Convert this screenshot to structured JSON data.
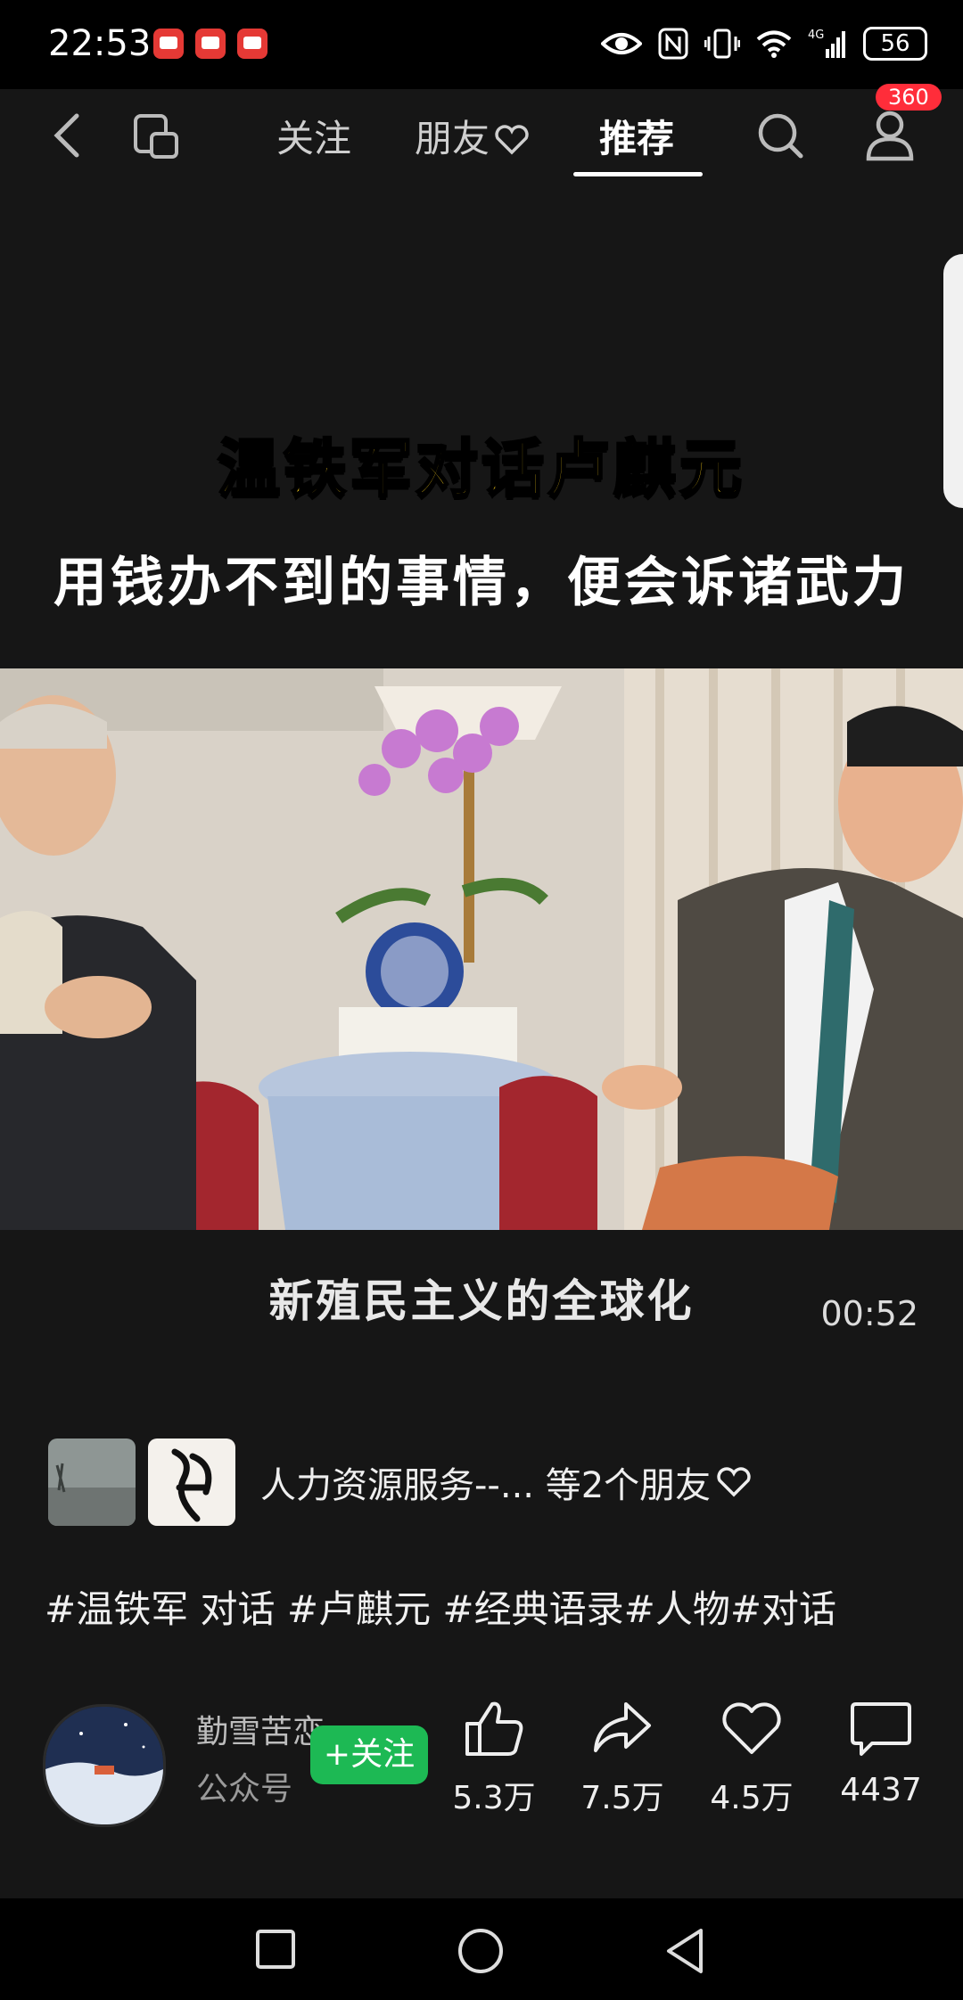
{
  "status_bar": {
    "time": "22:53",
    "battery": "56"
  },
  "top_nav": {
    "tabs": [
      "关注",
      "朋友",
      "推荐"
    ],
    "active_tab": "推荐",
    "notification_badge": "360"
  },
  "video": {
    "title_line1": "温铁军对话卢麒元",
    "title_line2": "用钱办不到的事情，便会诉诸武力",
    "subtitle": "新殖民主义的全球化",
    "duration": "00:52"
  },
  "friends": {
    "text": "人力资源服务--... 等2个朋友"
  },
  "hashtags": "#温铁军 对话 #卢麒元 #经典语录#人物#对话",
  "author": {
    "name": "勤雪苦恋",
    "subtitle": "公众号",
    "follow_label": "+关注"
  },
  "actions": {
    "likes": "5.3万",
    "shares": "7.5万",
    "favorites": "4.5万",
    "comments": "4437"
  },
  "colors": {
    "accent_green": "#1db954",
    "title_yellow": "#ffd21a",
    "badge_red": "#ff2d3a"
  }
}
